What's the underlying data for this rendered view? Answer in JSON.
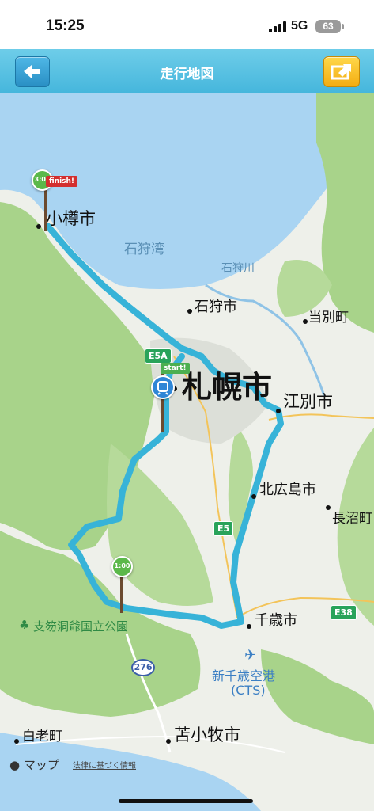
{
  "status": {
    "time": "15:25",
    "network": "5G",
    "battery": "63"
  },
  "nav": {
    "title": "走行地図"
  },
  "map": {
    "cities": {
      "otaru": "小樽市",
      "sapporo": "札幌市",
      "ishikari": "石狩市",
      "tobetsu": "当別町",
      "ebetsu": "江別市",
      "kitahiroshima": "北広島市",
      "naganuma": "長沼町",
      "chitose": "千歳市",
      "shiraoi": "白老町",
      "tomakomai": "苫小牧市"
    },
    "water": {
      "ishikari_bay": "石狩湾",
      "ishikari_river": "石狩川"
    },
    "park": "支笏洞爺国立公園",
    "airport": {
      "name": "新千歳空港",
      "code": "(CTS)"
    },
    "roads": {
      "e5a": "E5A",
      "e5": "E5",
      "e38": "E38",
      "r276": "276"
    },
    "markers": {
      "finish_flag": "finish!",
      "start_flag": "start!",
      "goal_time": "3:00",
      "checkpoint_time": "1:00"
    }
  },
  "footer": {
    "maps_brand": "マップ",
    "legal": "法律に基づく情報"
  },
  "colors": {
    "route": "#37b3d8",
    "water": "#a9d4f2",
    "land": "#eef0ea",
    "forest": "#a8d38a",
    "nav": "#4dbbe0"
  }
}
